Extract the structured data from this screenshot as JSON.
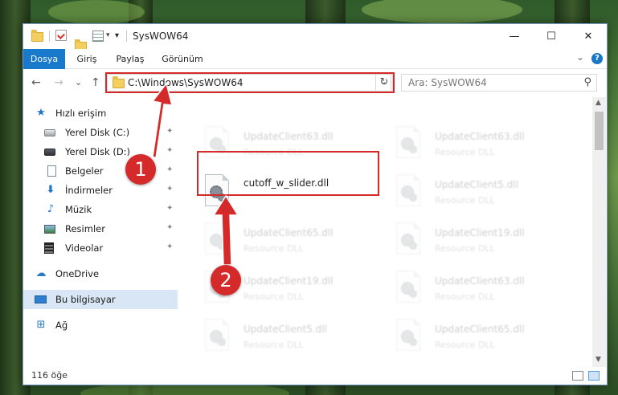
{
  "window": {
    "title": "SysWOW64",
    "buttons": {
      "minimize": "—",
      "maximize": "☐",
      "close": "✕"
    }
  },
  "ribbon": {
    "tabs": [
      {
        "label": "Dosya",
        "active": true
      },
      {
        "label": "Giriş",
        "active": false
      },
      {
        "label": "Paylaş",
        "active": false
      },
      {
        "label": "Görünüm",
        "active": false
      }
    ],
    "expand_glyph": "⌄",
    "help_glyph": "?"
  },
  "nav": {
    "back": "←",
    "forward": "→",
    "recent": "⌄",
    "up": "↑",
    "address": "C:\\Windows\\SysWOW64",
    "address_dropdown": "⌄",
    "refresh": "↻",
    "search_placeholder": "Ara: SysWOW64",
    "search_icon": "search-icon"
  },
  "sidebar": {
    "quick_access": "Hızlı erişim",
    "items": [
      {
        "label": "Yerel Disk (C:)",
        "icon": "drive-icon",
        "pinned": true
      },
      {
        "label": "Yerel Disk (D:)",
        "icon": "drive-icon",
        "pinned": true
      },
      {
        "label": "Belgeler",
        "icon": "documents-icon",
        "pinned": true
      },
      {
        "label": "İndirmeler",
        "icon": "download-icon",
        "pinned": true
      },
      {
        "label": "Müzik",
        "icon": "music-icon",
        "pinned": true
      },
      {
        "label": "Resimler",
        "icon": "pictures-icon",
        "pinned": true
      },
      {
        "label": "Videolar",
        "icon": "videos-icon",
        "pinned": true
      }
    ],
    "onedrive": "OneDrive",
    "this_pc": "Bu bilgisayar",
    "network": "Ağ",
    "pin_glyph": "📌"
  },
  "files": {
    "left_column": [
      {
        "name": "UpdateClient63.dll",
        "type": "Resource DLL",
        "faded": true
      },
      {
        "name": "cutoff_w_slider.dll",
        "type": "",
        "faded": false
      },
      {
        "name": "UpdateClient65.dll",
        "type": "Resource DLL",
        "faded": true
      },
      {
        "name": "UpdateClient19.dll",
        "type": "Resource DLL",
        "faded": true
      },
      {
        "name": "UpdateClient5.dll",
        "type": "Resource DLL",
        "faded": true
      }
    ],
    "right_column": [
      {
        "name": "UpdateClient63.dll",
        "type": "Resource DLL",
        "faded": true
      },
      {
        "name": "UpdateClient5.dll",
        "type": "Resource DLL",
        "faded": true
      },
      {
        "name": "UpdateClient19.dll",
        "type": "Resource DLL",
        "faded": true
      },
      {
        "name": "UpdateClient63.dll",
        "type": "Resource DLL",
        "faded": true
      },
      {
        "name": "UpdateClient65.dll",
        "type": "Resource DLL",
        "faded": true
      }
    ]
  },
  "status": {
    "item_count": "116 öğe"
  },
  "annotations": {
    "step1": "1",
    "step2": "2"
  },
  "colors": {
    "accent": "#1979ca",
    "highlight": "#d42a2a",
    "selected": "#d9e6f5"
  }
}
